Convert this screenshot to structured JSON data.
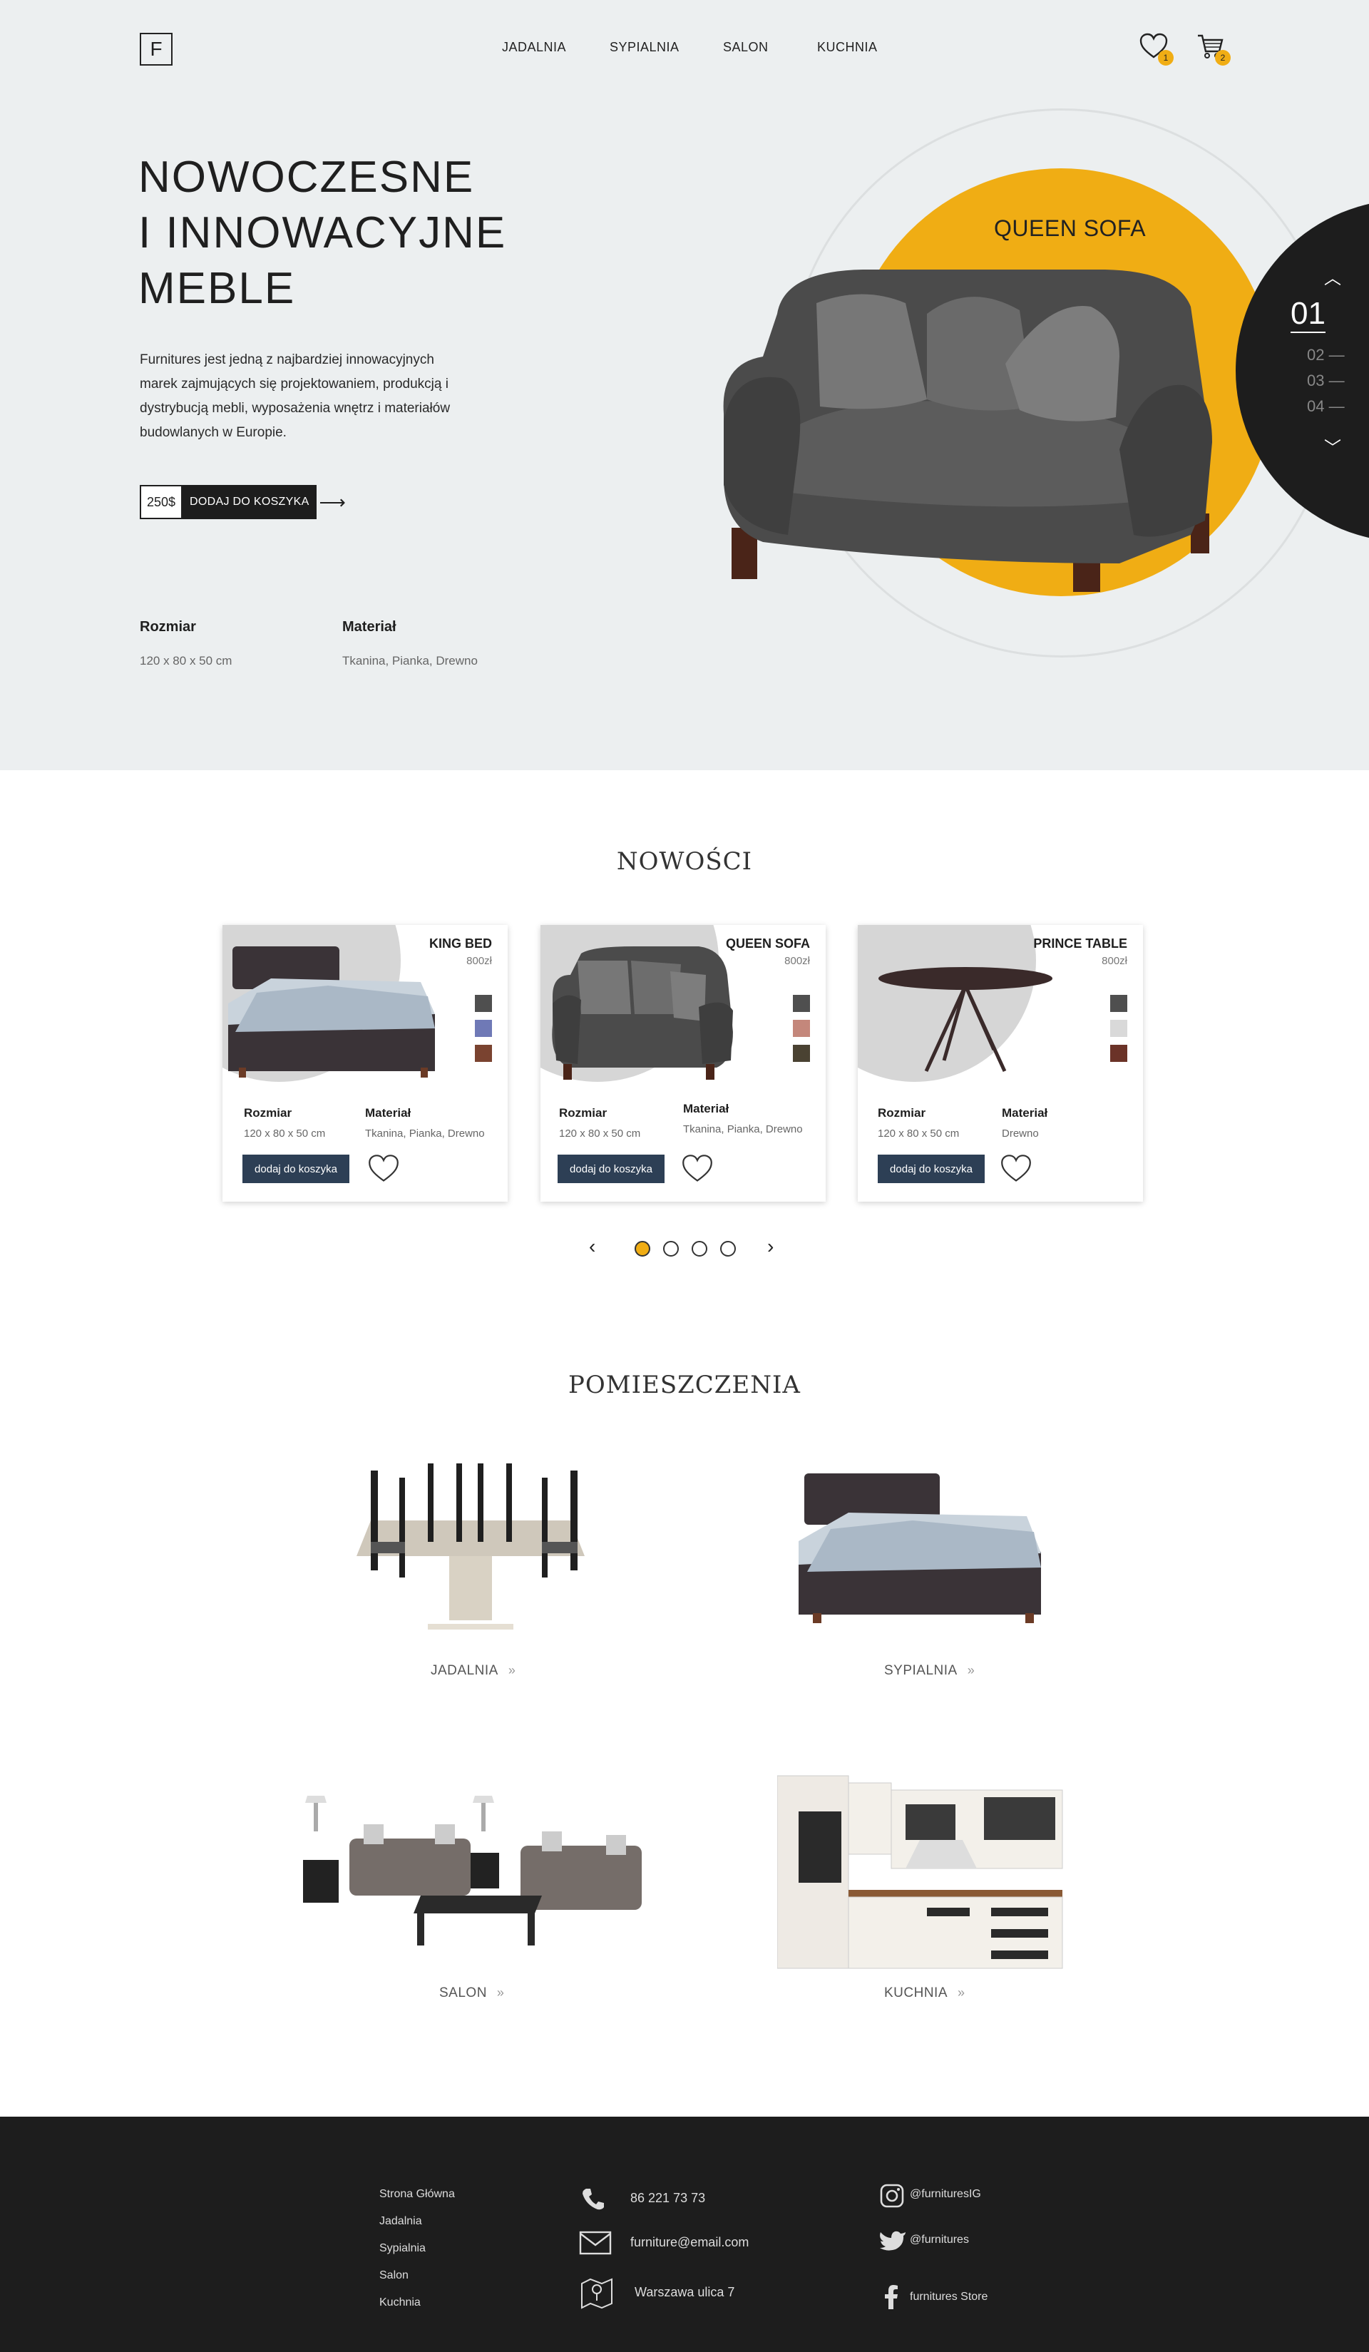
{
  "header": {
    "logo": "F",
    "nav": [
      "JADALNIA",
      "SYPIALNIA",
      "SALON",
      "KUCHNIA"
    ],
    "wishlist_count": "1",
    "cart_count": "2",
    "icons": [
      "heart-icon",
      "cart-icon"
    ]
  },
  "hero": {
    "title_lines": [
      "NOWOCZESNE",
      "I INNOWACYJNE",
      "MEBLE"
    ],
    "description": "Furnitures jest jedną z najbardziej innowacyjnych marek zajmujących się projektowaniem, produkcją i dystrybucją mebli, wyposażenia wnętrz i materiałów budowlanych w Europie.",
    "price": "250$",
    "cta": "DODAJ DO KOSZYKA",
    "size_label": "Rozmiar",
    "size_value": "120  x  80  x  50 cm",
    "material_label": "Materiał",
    "material_value": "Tkanina, Pianka, Drewno",
    "featured_name": "QUEEN SOFA",
    "slides": [
      "01",
      "02",
      "03",
      "04"
    ],
    "colors": {
      "accent": "#f0ad14",
      "dark": "#1d1d1d",
      "bg": "#eceff0"
    }
  },
  "news": {
    "title": "NOWOŚCI",
    "cards": [
      {
        "name": "KING BED",
        "price": "800zł",
        "size_label": "Rozmiar",
        "size": "120  x  80  x  50 cm",
        "material_label": "Materiał",
        "material": "Tkanina, Pianka, Drewno",
        "button": "dodaj do koszyka",
        "swatches": [
          "#4f4f4f",
          "#6f79b6",
          "#7a4330"
        ]
      },
      {
        "name": "QUEEN SOFA",
        "price": "800zł",
        "size_label": "Rozmiar",
        "size": "120  x  80  x  50 cm",
        "material_label": "Materiał",
        "material": "Tkanina, Pianka, Drewno",
        "button": "dodaj do koszyka",
        "swatches": [
          "#4f4f4f",
          "#c4877b",
          "#4a4232"
        ]
      },
      {
        "name": "PRINCE TABLE",
        "price": "800zł",
        "size_label": "Rozmiar",
        "size": "120  x  80  x  50 cm",
        "material_label": "Materiał",
        "material": "Drewno",
        "button": "dodaj do koszyka",
        "swatches": [
          "#4f4f4f",
          "#d9d9d9",
          "#6b3328"
        ]
      }
    ],
    "pager_dots": 4,
    "active_dot": 0
  },
  "rooms": {
    "title": "POMIESZCZENIA",
    "items": [
      {
        "label": "JADALNIA"
      },
      {
        "label": "SYPIALNIA"
      },
      {
        "label": "SALON"
      },
      {
        "label": "KUCHNIA"
      }
    ],
    "arrow": "»"
  },
  "footer": {
    "links": [
      "Strona Główna",
      "Jadalnia",
      "Sypialnia",
      "Salon",
      "Kuchnia"
    ],
    "phone": "86 221 73 73",
    "email": "furniture@email.com",
    "address": "Warszawa ulica 7",
    "instagram": "@furnituresIG",
    "twitter": "@furnitures",
    "facebook": "furnitures Store"
  }
}
